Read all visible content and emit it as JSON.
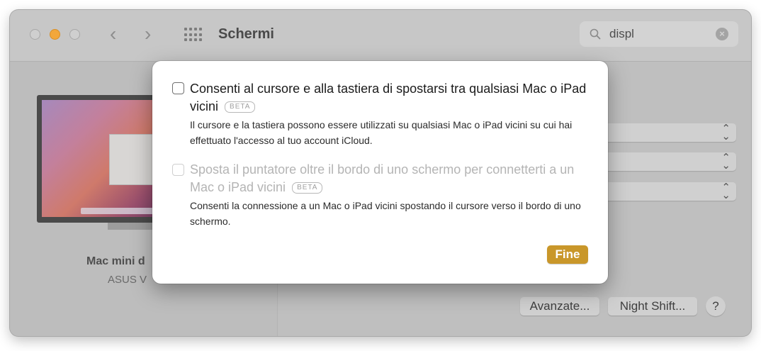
{
  "window": {
    "title": "Schermi",
    "nav_back_glyph": "‹",
    "nav_forward_glyph": "›"
  },
  "search": {
    "value": "displ",
    "clear_glyph": "×"
  },
  "display": {
    "name": "Mac mini d",
    "model": "ASUS V"
  },
  "popups": [
    "",
    "",
    ""
  ],
  "buttons": {
    "advanced": "Avanzate...",
    "night_shift": "Night Shift...",
    "help": "?"
  },
  "dialog": {
    "option1": {
      "title": "Consenti al cursore e alla tastiera di spostarsi tra qualsiasi Mac o iPad vicini",
      "badge": "BETA",
      "description": "Il cursore e la tastiera possono essere utilizzati su qualsiasi Mac o iPad vicini su cui hai effettuato l'accesso al tuo account iCloud.",
      "checked": false
    },
    "option2": {
      "title": "Sposta il puntatore oltre il bordo di uno schermo per connetterti a un Mac o iPad vicini",
      "badge": "BETA",
      "description": "Consenti la connessione a un Mac o iPad vicini spostando il cursore verso il bordo di uno schermo.",
      "checked": false,
      "enabled": false
    },
    "done_label": "Fine"
  },
  "colors": {
    "accent_button": "#c9972a",
    "minimize_light": "#f2a73b"
  },
  "icons": {
    "grid": "grid-icon",
    "search": "search-icon",
    "clear": "clear-icon",
    "popup_chevron": "updown-chevron-icon"
  }
}
